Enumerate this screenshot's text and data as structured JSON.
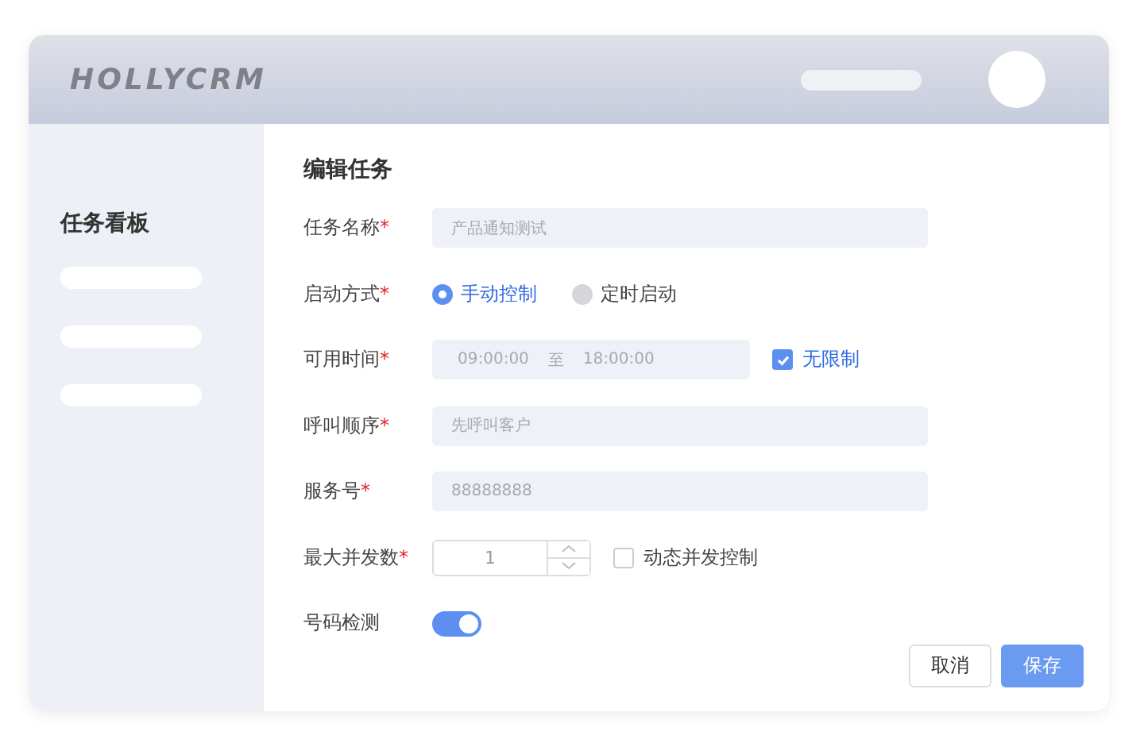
{
  "header": {
    "logo": "HOLLYCRM"
  },
  "sidebar": {
    "title": "任务看板"
  },
  "form": {
    "title": "编辑任务",
    "fields": [
      {
        "kind": "text",
        "label": "任务名称",
        "required_mark": "*",
        "value": "产品通知测试"
      },
      {
        "kind": "radio",
        "label": "启动方式",
        "required_mark": "*",
        "options": [
          {
            "label": "手动控制",
            "selected": true
          },
          {
            "label": "定时启动",
            "selected": false
          }
        ]
      },
      {
        "kind": "timerange",
        "label": "可用时间",
        "required_mark": "*",
        "start": "09:00:00",
        "separator": "至",
        "end": "18:00:00",
        "checkbox": {
          "label": "无限制",
          "checked": true
        }
      },
      {
        "kind": "text",
        "label": "呼叫顺序",
        "required_mark": "*",
        "value": "先呼叫客户"
      },
      {
        "kind": "text",
        "label": "服务号",
        "required_mark": "*",
        "value": "88888888"
      },
      {
        "kind": "number",
        "label": "最大并发数",
        "required_mark": "*",
        "value": "1",
        "checkbox": {
          "label": "动态并发控制",
          "checked": false
        }
      },
      {
        "kind": "switch",
        "label": "号码检测",
        "on": true
      }
    ],
    "buttons": [
      {
        "label": "取消",
        "kind": "default"
      },
      {
        "label": "保存",
        "kind": "primary"
      }
    ]
  }
}
